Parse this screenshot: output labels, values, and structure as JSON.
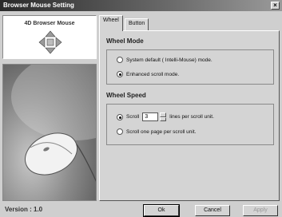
{
  "window": {
    "title": "Browser Mouse Setting",
    "close_glyph": "×"
  },
  "logo": {
    "text": "4D Browser Mouse",
    "icon": "four-way-arrows-icon"
  },
  "version_label": "Version : 1.0",
  "tabs": [
    {
      "label": "Wheel",
      "active": true
    },
    {
      "label": "Button",
      "active": false
    }
  ],
  "wheel_mode": {
    "title": "Wheel Mode",
    "options": [
      {
        "label": "System default ( Intelli-Mouse) mode.",
        "selected": false
      },
      {
        "label": "Enhanced scroll mode.",
        "selected": true
      }
    ]
  },
  "wheel_speed": {
    "title": "Wheel Speed",
    "scroll_label": "Scroll",
    "scroll_value": "3",
    "scroll_suffix": "lines per scroll unit.",
    "page_option": "Scroll one page per scroll unit.",
    "scroll_selected": true
  },
  "buttons": {
    "ok": "Ok",
    "cancel": "Cancel",
    "apply": "Apply"
  }
}
